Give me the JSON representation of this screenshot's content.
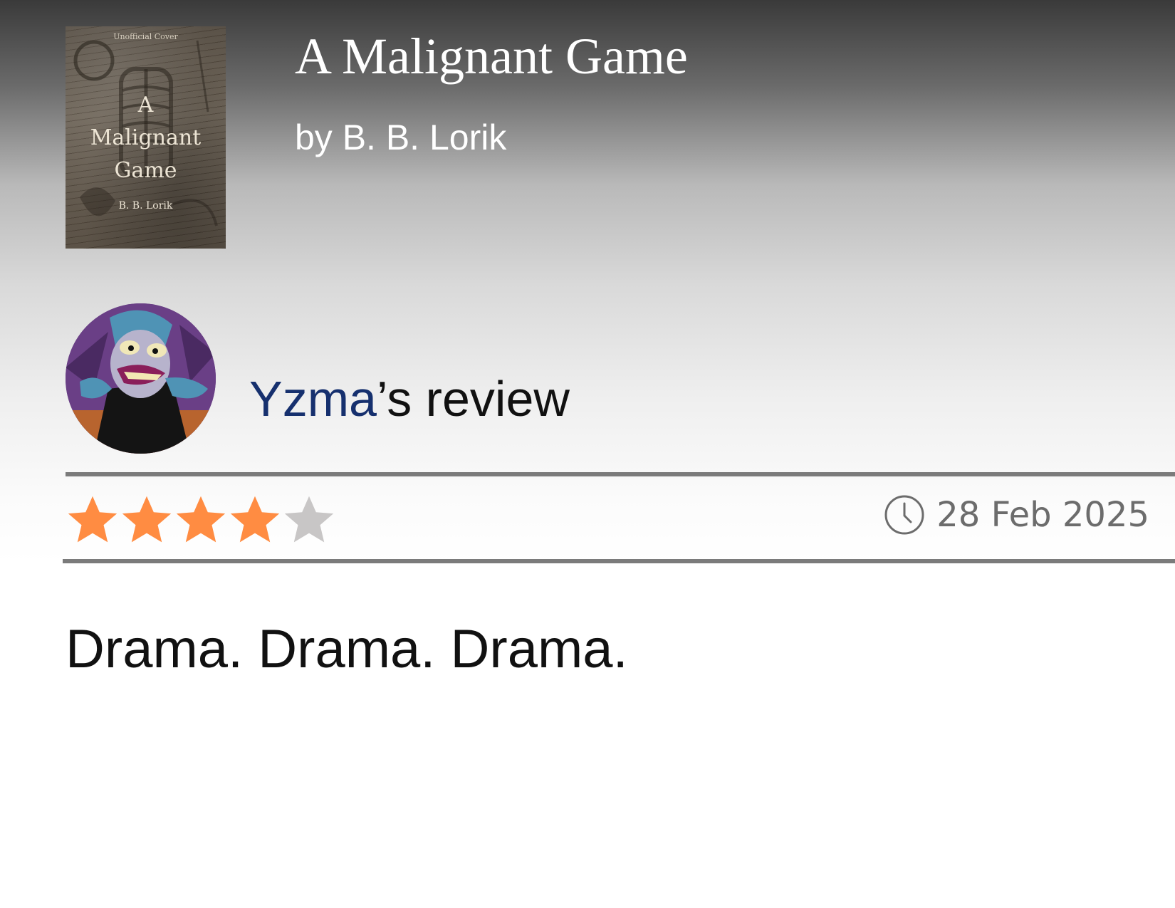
{
  "book": {
    "title": "A Malignant Game",
    "byline": "by B. B. Lorik",
    "cover": {
      "note": "Unofficial Cover",
      "title_line1": "A",
      "title_line2": "Malignant",
      "title_line3": "Game",
      "author": "B. B. Lorik"
    }
  },
  "review": {
    "reviewer": "Yzma",
    "heading_suffix": "’s review",
    "rating": 4,
    "rating_max": 5,
    "date": "28 Feb 2025",
    "body": "Drama. Drama. Drama."
  },
  "colors": {
    "star_filled": "#ff8c42",
    "star_empty": "#c8c6c6",
    "reviewer_link": "#16306e"
  },
  "icons": {
    "clock": "clock-icon",
    "star": "star-icon"
  }
}
